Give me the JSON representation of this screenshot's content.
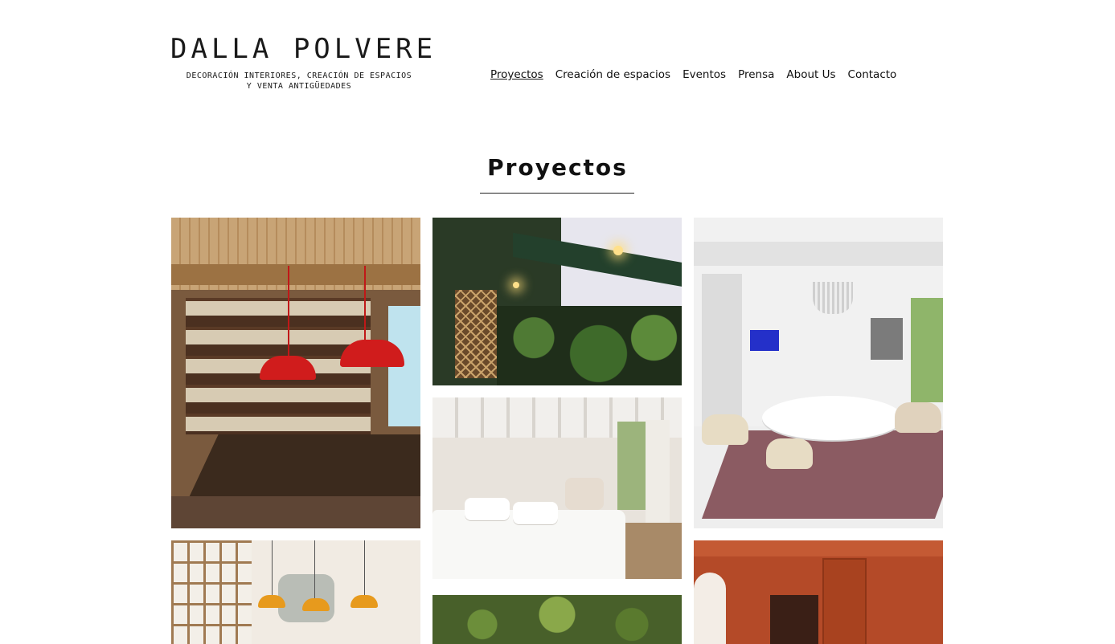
{
  "brand": {
    "title": "DALLA POLVERE",
    "subtitle_line1": "DECORACIÓN INTERIORES, CREACIÓN DE ESPACIOS",
    "subtitle_line2": "Y VENTA ANTIGÜEDADES"
  },
  "nav": {
    "items": [
      {
        "label": "Proyectos",
        "active": true
      },
      {
        "label": "Creación de espacios",
        "active": false
      },
      {
        "label": "Eventos",
        "active": false
      },
      {
        "label": "Prensa",
        "active": false
      },
      {
        "label": "About Us",
        "active": false
      },
      {
        "label": "Contacto",
        "active": false
      }
    ]
  },
  "section": {
    "title": "Proyectos"
  },
  "colors": {
    "background": "#ffffff",
    "text": "#111111",
    "lamp_red": "#d01c1c",
    "lamp_amber": "#e79a1d",
    "tv_blue": "#2430c9"
  }
}
